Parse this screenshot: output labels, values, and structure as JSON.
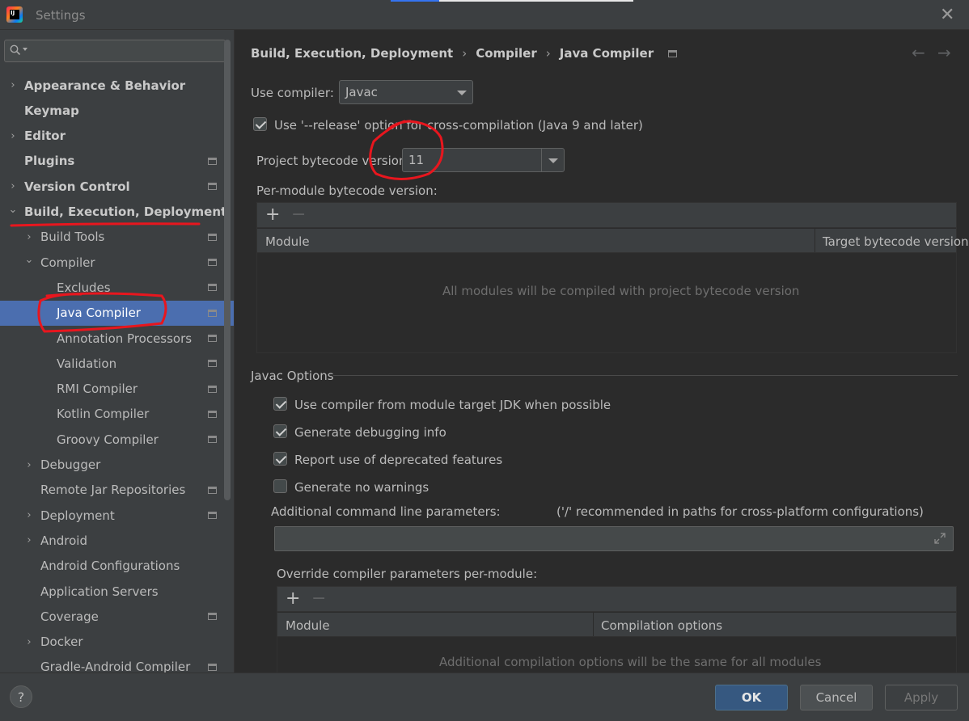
{
  "window": {
    "title": "Settings"
  },
  "sidebar": {
    "search_placeholder": "",
    "items": [
      {
        "label": "Appearance & Behavior",
        "expandable": true,
        "expanded": false,
        "level": 0,
        "bold": true,
        "project": false
      },
      {
        "label": "Keymap",
        "expandable": false,
        "level": 0,
        "bold": true,
        "project": false
      },
      {
        "label": "Editor",
        "expandable": true,
        "expanded": false,
        "level": 0,
        "bold": true,
        "project": false
      },
      {
        "label": "Plugins",
        "expandable": false,
        "level": 0,
        "bold": true,
        "project": true
      },
      {
        "label": "Version Control",
        "expandable": true,
        "expanded": false,
        "level": 0,
        "bold": true,
        "project": true
      },
      {
        "label": "Build, Execution, Deployment",
        "expandable": true,
        "expanded": true,
        "level": 0,
        "bold": true,
        "project": false
      },
      {
        "label": "Build Tools",
        "expandable": true,
        "expanded": false,
        "level": 1,
        "bold": false,
        "project": true
      },
      {
        "label": "Compiler",
        "expandable": true,
        "expanded": true,
        "level": 1,
        "bold": false,
        "project": true
      },
      {
        "label": "Excludes",
        "expandable": false,
        "level": 2,
        "bold": false,
        "project": true
      },
      {
        "label": "Java Compiler",
        "expandable": false,
        "level": 2,
        "bold": false,
        "project": true,
        "selected": true
      },
      {
        "label": "Annotation Processors",
        "expandable": false,
        "level": 2,
        "bold": false,
        "project": true
      },
      {
        "label": "Validation",
        "expandable": false,
        "level": 2,
        "bold": false,
        "project": true
      },
      {
        "label": "RMI Compiler",
        "expandable": false,
        "level": 2,
        "bold": false,
        "project": true
      },
      {
        "label": "Kotlin Compiler",
        "expandable": false,
        "level": 2,
        "bold": false,
        "project": true
      },
      {
        "label": "Groovy Compiler",
        "expandable": false,
        "level": 2,
        "bold": false,
        "project": true
      },
      {
        "label": "Debugger",
        "expandable": true,
        "expanded": false,
        "level": 1,
        "bold": false,
        "project": false
      },
      {
        "label": "Remote Jar Repositories",
        "expandable": false,
        "level": 1,
        "bold": false,
        "project": true
      },
      {
        "label": "Deployment",
        "expandable": true,
        "expanded": false,
        "level": 1,
        "bold": false,
        "project": true
      },
      {
        "label": "Android",
        "expandable": true,
        "expanded": false,
        "level": 1,
        "bold": false,
        "project": false
      },
      {
        "label": "Android Configurations",
        "expandable": false,
        "level": 1,
        "bold": false,
        "project": false
      },
      {
        "label": "Application Servers",
        "expandable": false,
        "level": 1,
        "bold": false,
        "project": false
      },
      {
        "label": "Coverage",
        "expandable": false,
        "level": 1,
        "bold": false,
        "project": true
      },
      {
        "label": "Docker",
        "expandable": true,
        "expanded": false,
        "level": 1,
        "bold": false,
        "project": false
      },
      {
        "label": "Gradle-Android Compiler",
        "expandable": false,
        "level": 1,
        "bold": false,
        "project": true
      }
    ]
  },
  "breadcrumb": [
    "Build, Execution, Deployment",
    "Compiler",
    "Java Compiler"
  ],
  "compiler": {
    "use_compiler_label": "Use compiler:",
    "use_compiler_value": "Javac",
    "release_option_label": "Use '--release' option for cross-compilation (Java 9 and later)",
    "release_option_checked": true,
    "bytecode_label": "Project bytecode version:",
    "bytecode_value": "11",
    "per_module_label": "Per-module bytecode version:",
    "per_module_table": {
      "columns": [
        "Module",
        "Target bytecode version"
      ],
      "empty_text": "All modules will be compiled with project bytecode version"
    }
  },
  "javac_options": {
    "section_title": "Javac Options",
    "checkboxes": [
      {
        "label": "Use compiler from module target JDK when possible",
        "checked": true
      },
      {
        "label": "Generate debugging info",
        "checked": true
      },
      {
        "label": "Report use of deprecated features",
        "checked": true
      },
      {
        "label": "Generate no warnings",
        "checked": false
      }
    ],
    "additional_params_label": "Additional command line parameters:",
    "additional_params_hint": "('/' recommended in paths for cross-platform configurations)",
    "additional_params_value": "",
    "override_label": "Override compiler parameters per-module:",
    "override_table": {
      "columns": [
        "Module",
        "Compilation options"
      ],
      "empty_text": "Additional compilation options will be the same for all modules"
    }
  },
  "buttons": {
    "ok": "OK",
    "cancel": "Cancel",
    "apply": "Apply",
    "help": "?"
  },
  "icons": {
    "app": "intellij-logo-icon",
    "close": "close-icon",
    "search": "search-icon",
    "back": "arrow-left-icon",
    "forward": "arrow-right-icon",
    "project_scope": "project-scope-icon",
    "add": "plus-icon",
    "remove": "minus-icon",
    "expand": "expand-icon"
  },
  "colors": {
    "selection": "#4b6eaf",
    "primary_button": "#365880",
    "annotation": "#e8161e"
  }
}
